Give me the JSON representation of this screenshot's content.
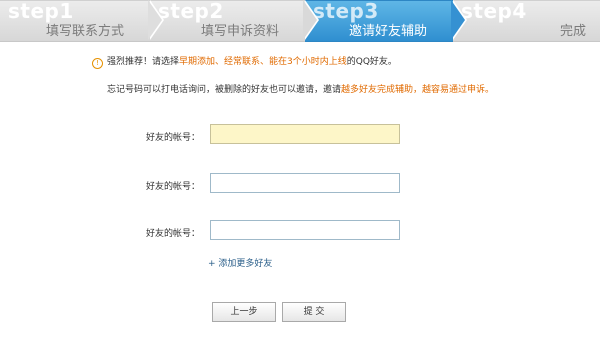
{
  "steps": [
    {
      "num": "step1",
      "title": "填写联系方式"
    },
    {
      "num": "step2",
      "title": "填写申诉资料"
    },
    {
      "num": "step3",
      "title": "邀请好友辅助"
    },
    {
      "num": "step4",
      "title": "完成"
    }
  ],
  "notice": {
    "prefix": "强烈推荐！请选择",
    "highlight": "早期添加、经常联系、能在3个小时内上线",
    "suffix": "的QQ好友。"
  },
  "description": {
    "prefix": "忘记号码可以打电话询问，被删除的好友也可以邀请，邀请",
    "highlight": "越多好友完成辅助，越容易通过申诉。"
  },
  "fields": [
    {
      "label": "好友的帐号：",
      "value": ""
    },
    {
      "label": "好友的帐号：",
      "value": ""
    },
    {
      "label": "好友的帐号：",
      "value": ""
    }
  ],
  "add_more": "+ 添加更多好友",
  "buttons": {
    "prev": "上一步",
    "submit": "提  交"
  },
  "colors": {
    "active_step": "#3a9ad9",
    "highlight": "#e06a00",
    "focused_input": "#fdf6c8"
  }
}
